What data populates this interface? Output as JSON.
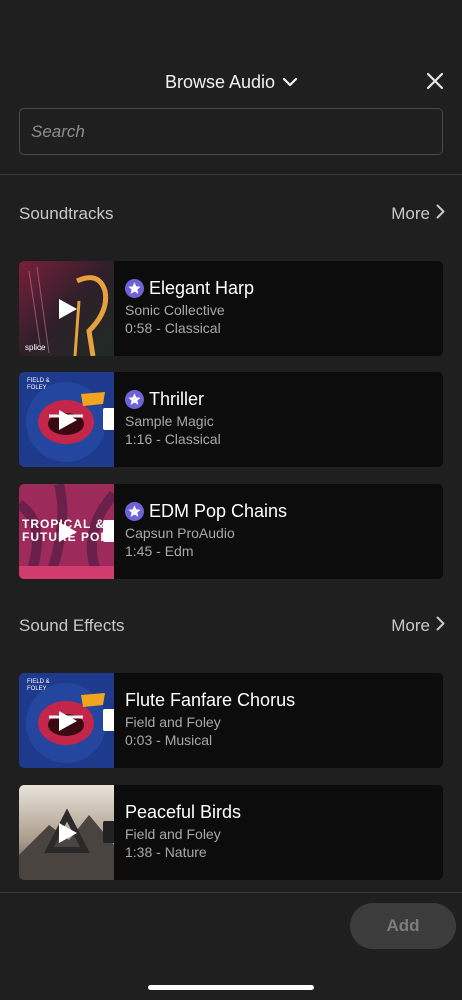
{
  "header": {
    "title": "Browse Audio"
  },
  "search": {
    "placeholder": "Search"
  },
  "soundtracks": {
    "title": "Soundtracks",
    "more_label": "More",
    "items": [
      {
        "name": "Elegant Harp",
        "artist": "Sonic Collective",
        "info": "0:58 - Classical",
        "premium": true,
        "thumb_text": "splice"
      },
      {
        "name": "Thriller",
        "artist": "Sample Magic",
        "info": "1:16 - Classical",
        "premium": true,
        "thumb_text": "FIELD & FOLEY"
      },
      {
        "name": "EDM Pop Chains",
        "artist": "Capsun ProAudio",
        "info": "1:45 - Edm",
        "premium": true,
        "thumb_text": "TROPICAL & FUTURE POP"
      }
    ]
  },
  "sound_effects": {
    "title": "Sound Effects",
    "more_label": "More",
    "items": [
      {
        "name": "Flute Fanfare Chorus",
        "artist": "Field and Foley",
        "info": "0:03 - Musical",
        "premium": false,
        "thumb_text": "FIELD & FOLEY"
      },
      {
        "name": "Peaceful Birds",
        "artist": "Field and Foley",
        "info": "1:38 - Nature",
        "premium": false
      }
    ]
  },
  "footer": {
    "add_label": "Add"
  },
  "colors": {
    "background": "#1f1f1f",
    "card": "#0c0c0c",
    "premium": "#6e63d6"
  }
}
